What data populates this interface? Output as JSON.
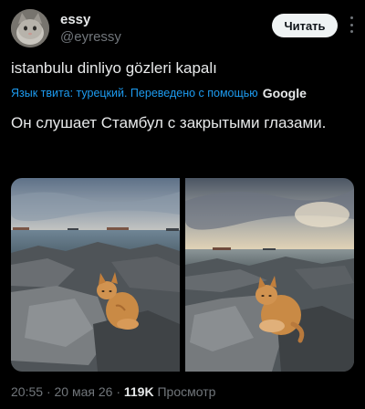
{
  "author": {
    "display_name": "essy",
    "handle": "@eyressy",
    "avatar_icon": "cat-avatar-icon"
  },
  "header": {
    "read_button": "Читать",
    "more_icon": "more-vertical-icon"
  },
  "tweet": {
    "original_text": "istanbulu dinliyo gözleri kapalı",
    "translation_note": "Язык твита: турецкий. Переведено с помощью",
    "translation_provider": "Google",
    "translated_text": "Он слушает Стамбул с закрытыми глазами."
  },
  "media": [
    {
      "icon": "photo-cat-on-rocks-sea-left"
    },
    {
      "icon": "photo-cat-on-rocks-sea-right"
    }
  ],
  "meta": {
    "time": "20:55",
    "separator1": "·",
    "date": "20 мая 26",
    "separator2": "·",
    "views_count": "119K",
    "views_label": "Просмотр"
  },
  "colors": {
    "background": "#000000",
    "text": "#e7e9ea",
    "secondary": "#71767b",
    "link": "#1d9bf0",
    "button_bg": "#eff3f4"
  }
}
